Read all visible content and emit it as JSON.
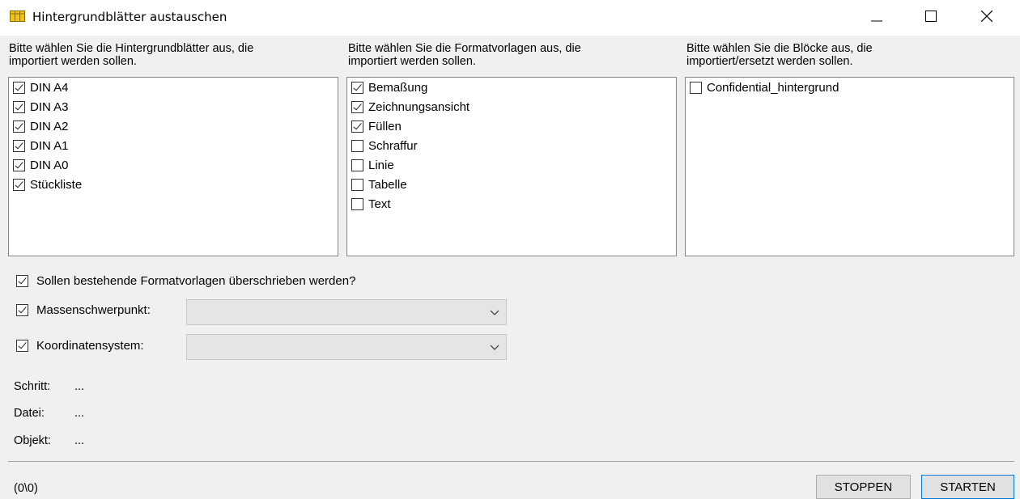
{
  "window": {
    "title": "Hintergrundblätter austauschen",
    "icon": "sheets-grid-icon",
    "controls": [
      "minimize-icon",
      "maximize-icon",
      "close-icon"
    ]
  },
  "columns": [
    {
      "header": "Bitte wählen Sie die Hintergrundblätter aus, die\nimportiert werden sollen.",
      "items": [
        {
          "label": "DIN A4",
          "checked": true
        },
        {
          "label": "DIN A3",
          "checked": true
        },
        {
          "label": "DIN A2",
          "checked": true
        },
        {
          "label": "DIN A1",
          "checked": true
        },
        {
          "label": "DIN A0",
          "checked": true
        },
        {
          "label": "Stückliste",
          "checked": true
        }
      ]
    },
    {
      "header": "Bitte wählen Sie die Formatvorlagen aus, die\nimportiert werden sollen.",
      "items": [
        {
          "label": "Bemaßung",
          "checked": true
        },
        {
          "label": "Zeichnungsansicht",
          "checked": true
        },
        {
          "label": "Füllen",
          "checked": true
        },
        {
          "label": "Schraffur",
          "checked": false
        },
        {
          "label": "Linie",
          "checked": false
        },
        {
          "label": "Tabelle",
          "checked": false
        },
        {
          "label": "Text",
          "checked": false
        }
      ]
    },
    {
      "header": "Bitte wählen Sie die Blöcke aus, die\nimportiert/ersetzt werden sollen.",
      "items": [
        {
          "label": "Confidential_hintergrund",
          "checked": false
        }
      ]
    }
  ],
  "options": {
    "overwrite": {
      "label": "Sollen bestehende Formatvorlagen überschrieben werden?",
      "checked": true
    },
    "centroid": {
      "label": "Massenschwerpunkt:",
      "checked": true,
      "value": ""
    },
    "coords": {
      "label": "Koordinatensystem:",
      "checked": true,
      "value": ""
    }
  },
  "status": {
    "step_label": "Schritt:",
    "step_value": "...",
    "file_label": "Datei:",
    "file_value": "...",
    "object_label": "Objekt:",
    "object_value": "..."
  },
  "counter": "(0\\0)",
  "buttons": {
    "stop": "STOPPEN",
    "start": "STARTEN"
  },
  "colors": {
    "accent": "#0078d7",
    "icon_yellow": "#f5c400"
  }
}
